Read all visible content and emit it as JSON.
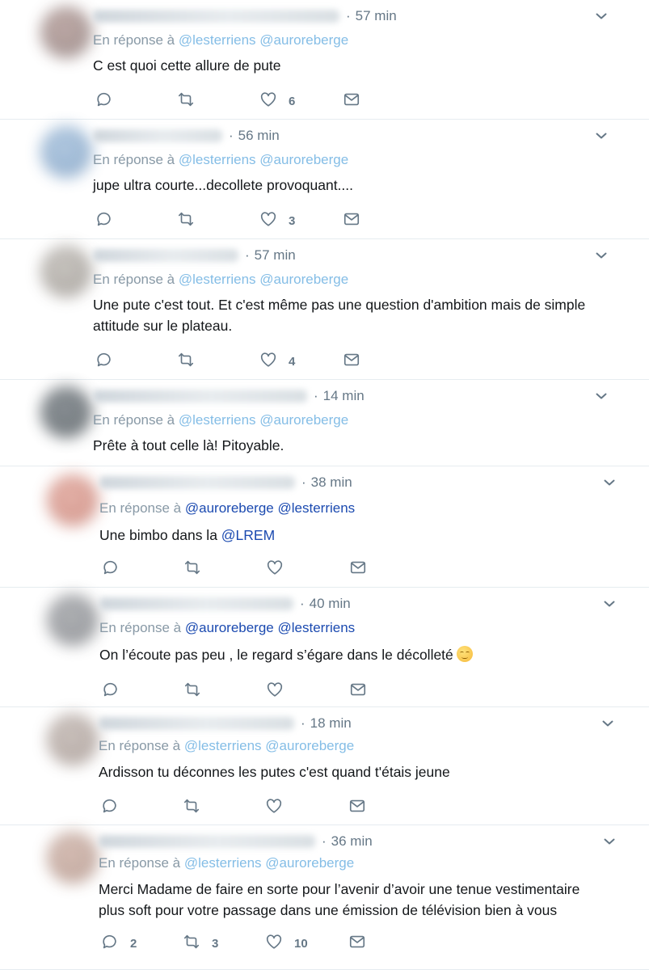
{
  "reply_prefix": "En réponse à",
  "tweets": [
    {
      "time": "57 min",
      "mentions": [
        "@lesterriens",
        "@auroreberge"
      ],
      "mention_style": "light",
      "lines": [
        "C est quoi cette allure de pute"
      ],
      "counts": {
        "reply": "",
        "retweet": "",
        "like": "6"
      },
      "avatar_colors": [
        "#b9a29e",
        "#8f7f7e"
      ]
    },
    {
      "time": "56 min",
      "mentions": [
        "@lesterriens",
        "@auroreberge"
      ],
      "mention_style": "light",
      "lines": [
        "jupe ultra courte...decollete provoquant...."
      ],
      "counts": {
        "reply": "",
        "retweet": "",
        "like": "3"
      },
      "avatar_colors": [
        "#aac4de",
        "#7f9fc2"
      ]
    },
    {
      "time": "57 min",
      "mentions": [
        "@lesterriens",
        "@auroreberge"
      ],
      "mention_style": "light",
      "lines": [
        "Une pute c'est tout. Et c'est même pas une question d'ambition mais de simple",
        "attitude sur le plateau."
      ],
      "counts": {
        "reply": "",
        "retweet": "",
        "like": "4"
      },
      "avatar_colors": [
        "#c4c0bb",
        "#9a958f"
      ]
    },
    {
      "time": "14 min",
      "mentions": [
        "@lesterriens",
        "@auroreberge"
      ],
      "mention_style": "light",
      "lines": [
        "Prête à tout celle là! Pitoyable."
      ],
      "counts": {
        "reply": "",
        "retweet": "",
        "like": ""
      },
      "avatar_colors": [
        "#7d8489",
        "#5c6368"
      ],
      "no_actions": true
    },
    {
      "time": "38 min",
      "mentions": [
        "@auroreberge",
        "@lesterriens"
      ],
      "mention_style": "dark",
      "lines": [
        "Une bimbo dans la "
      ],
      "link": "@LREM",
      "counts": {
        "reply": "",
        "retweet": "",
        "like": ""
      },
      "avatar_colors": [
        "#e2aaa0",
        "#c98579"
      ]
    },
    {
      "time": "40 min",
      "mentions": [
        "@auroreberge",
        "@lesterriens"
      ],
      "mention_style": "dark",
      "lines": [
        "On l’écoute pas peu , le regard s’égare dans le décolleté"
      ],
      "emoji": "relieved-face-emoji",
      "counts": {
        "reply": "",
        "retweet": "",
        "like": ""
      },
      "avatar_colors": [
        "#a7a9ad",
        "#86888c"
      ]
    },
    {
      "time": "18 min",
      "mentions": [
        "@lesterriens",
        "@auroreberge"
      ],
      "mention_style": "light",
      "lines": [
        "Ardisson tu déconnes les putes c'est quand t'étais jeune"
      ],
      "counts": {
        "reply": "",
        "retweet": "",
        "like": ""
      },
      "avatar_colors": [
        "#c6bcb7",
        "#a49791"
      ]
    },
    {
      "time": "36 min",
      "mentions": [
        "@lesterriens",
        "@auroreberge"
      ],
      "mention_style": "light",
      "lines": [
        "Merci Madame de faire en sorte pour l’avenir d’avoir une tenue vestimentaire",
        "plus soft pour votre passage dans une émission de télévision bien à vous"
      ],
      "counts": {
        "reply": "2",
        "retweet": "3",
        "like": "10"
      },
      "avatar_colors": [
        "#d2b8ae",
        "#b19489"
      ]
    }
  ],
  "icons": {
    "reply": "reply-icon",
    "retweet": "retweet-icon",
    "like": "heart-icon",
    "message": "direct-message-icon",
    "more": "chevron-down-icon"
  },
  "colors": {
    "icon": "#657786",
    "mention_light": "#84bde6",
    "mention_dark": "#1b4ab0",
    "divider": "#e6ecf0"
  }
}
